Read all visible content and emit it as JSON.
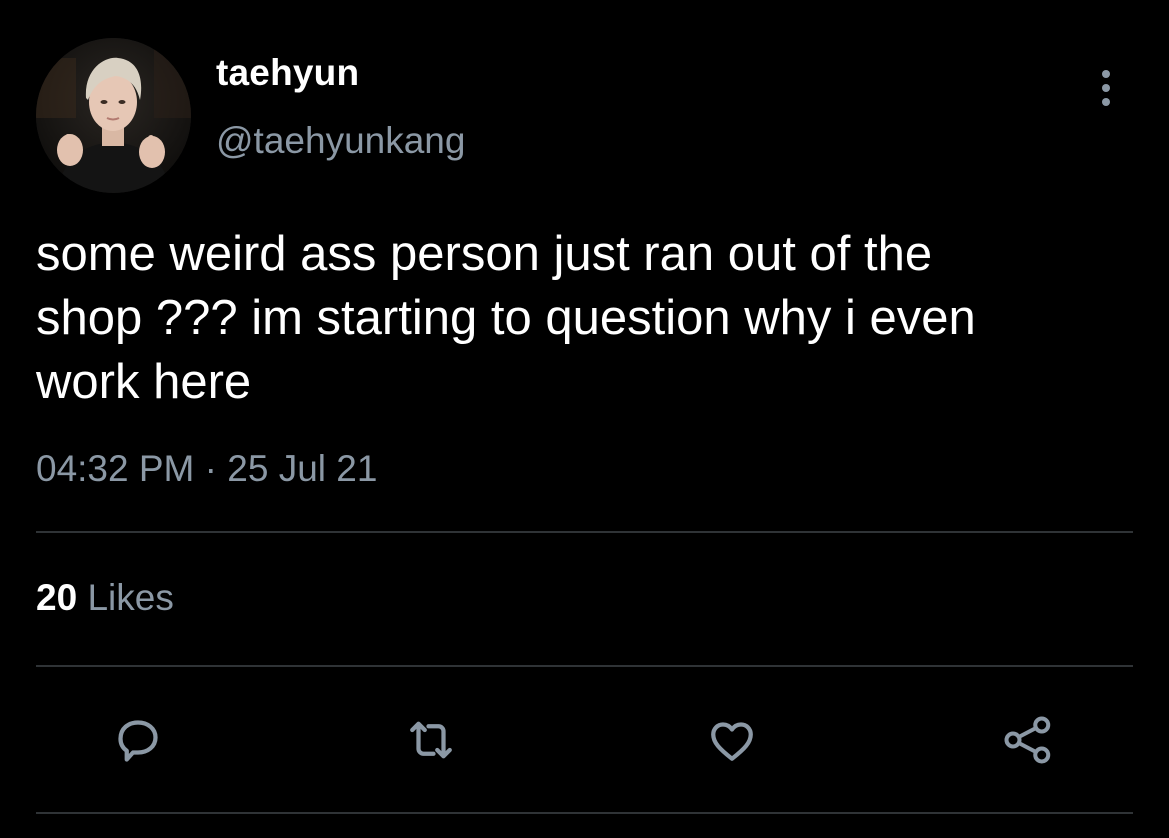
{
  "user": {
    "display_name": "taehyun",
    "handle": "@taehyunkang"
  },
  "tweet": {
    "text": "some weird ass person just ran out of the\nshop ??? im starting to question why i even\nwork here",
    "time": "04:32 PM",
    "separator": "·",
    "date": "25 Jul 21"
  },
  "stats": {
    "likes_count": "20",
    "likes_label": "Likes"
  },
  "icons": {
    "more": "more-vertical-icon",
    "reply": "reply-icon",
    "retweet": "retweet-icon",
    "like": "heart-icon",
    "share": "share-icon"
  },
  "colors": {
    "background": "#000000",
    "text": "#ffffff",
    "secondary": "#8b98a5",
    "divider": "#2f3336"
  }
}
